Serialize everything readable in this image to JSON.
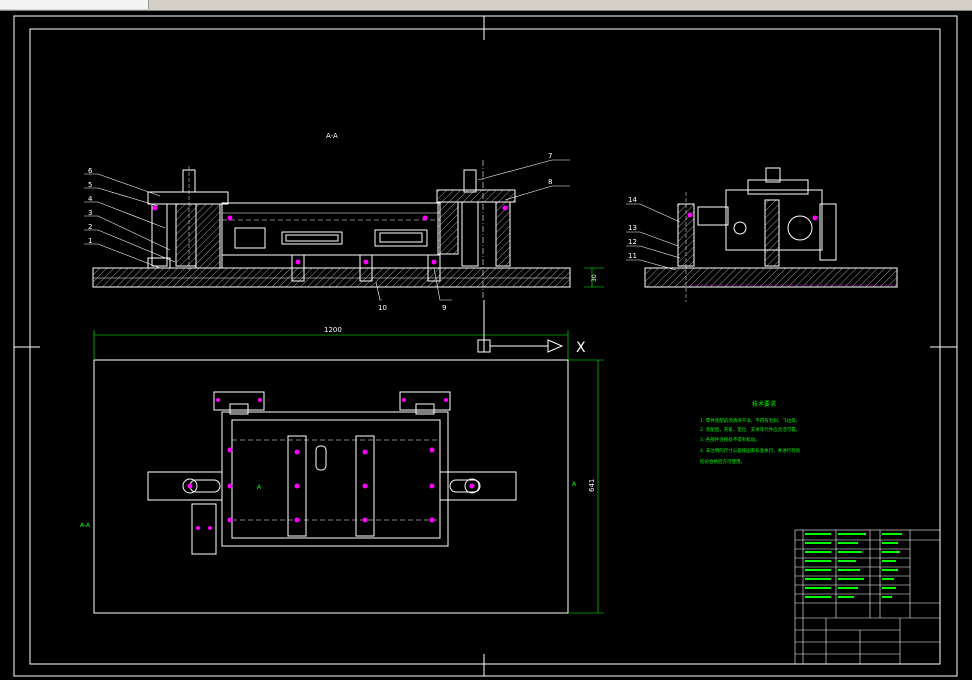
{
  "window": {
    "tab_label": ""
  },
  "section_label": "A-A",
  "dimension_length": "1200",
  "dimension_width": "641",
  "dimension_height": "30",
  "axis_x_label": "X",
  "section_marks": [
    "A-A",
    "A",
    "A"
  ],
  "part_numbers": [
    "1",
    "2",
    "3",
    "4",
    "5",
    "6",
    "7",
    "8",
    "9",
    "10",
    "11",
    "12",
    "13",
    "14"
  ],
  "notes_heading": "技术要求",
  "notes_lines": [
    "1. 零件装配前须清洗干净，不得有毛刺、飞边等。",
    "2. 装配后，夹紧、定位、支承等元件应灵活可靠。",
    "3. 各部件连接处不得有松动。",
    "4. 未注明的尺寸公差按国家标准执行，并进行检验",
    "   检验合格后方可使用。"
  ],
  "colors": {
    "background": "#000000",
    "line": "#ffffff",
    "accent": "#ff00ff",
    "notes": "#00ff00",
    "dimension": "#00ff00",
    "hatch": "#ffffff"
  }
}
